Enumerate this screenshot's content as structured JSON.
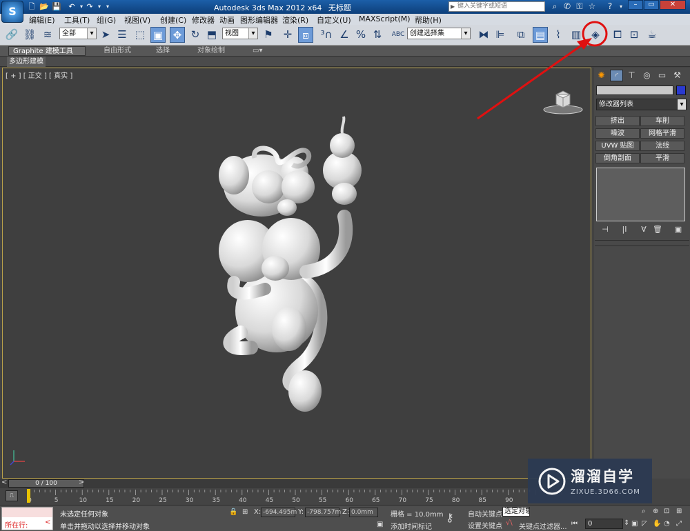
{
  "window": {
    "app_title": "Autodesk 3ds Max  2012 x64",
    "doc_title": "无标题",
    "search_placeholder": "键入关键字或短语",
    "logo_text": "S"
  },
  "menu": [
    "编辑(E)",
    "工具(T)",
    "组(G)",
    "视图(V)",
    "创建(C)",
    "修改器",
    "动画",
    "图形编辑器",
    "渲染(R)",
    "自定义(U)",
    "MAXScript(M)",
    "帮助(H)"
  ],
  "toolbar": {
    "selection_filter": "全部",
    "ref_coord": "视图",
    "named_selection": "创建选择集",
    "abc_label": "ABC"
  },
  "ribbon": {
    "tabs": [
      "Graphite 建模工具",
      "自由形式",
      "选择",
      "对象绘制"
    ],
    "active_tab": 0,
    "panel_label": "多边形建模"
  },
  "viewport": {
    "label": "[ + ] [ 正交 ] [ 真实 ]",
    "border_color": "#b9a14a",
    "object": "3D white balloon monkey model holding a gourd"
  },
  "command_panel": {
    "modifier_list": "修改器列表",
    "modifier_buttons": [
      "挤出",
      "车削",
      "噪波",
      "网格平滑",
      "UVW 贴图",
      "法线",
      "倒角剖面",
      "平滑"
    ],
    "object_color": "#2a3ad0"
  },
  "timeline": {
    "frame_indicator": "0 / 100",
    "ticks": [
      "0",
      "5",
      "10",
      "15",
      "20",
      "25",
      "30",
      "35",
      "40",
      "45",
      "50",
      "55",
      "60",
      "65",
      "70",
      "75",
      "80",
      "85",
      "90"
    ]
  },
  "status": {
    "running": "所在行:",
    "line1": "未选定任何对象",
    "line2": "单击并拖动以选择并移动对象",
    "x_label": "X:",
    "x_value": "-694.495m",
    "y_label": "Y:",
    "y_value": "-798.757m",
    "z_label": "Z:",
    "z_value": "0.0mm",
    "grid": "栅格 = 10.0mm",
    "add_time_tag": "添加时间标记",
    "auto_key": "自动关键点",
    "set_key": "设置关键点",
    "selected": "选定对象",
    "key_filters": "关键点过滤器...",
    "frame": "0"
  },
  "watermark": {
    "title": "溜溜自学",
    "url": "ZIXUE.3D66.COM"
  },
  "annotation_color": "#e01010"
}
